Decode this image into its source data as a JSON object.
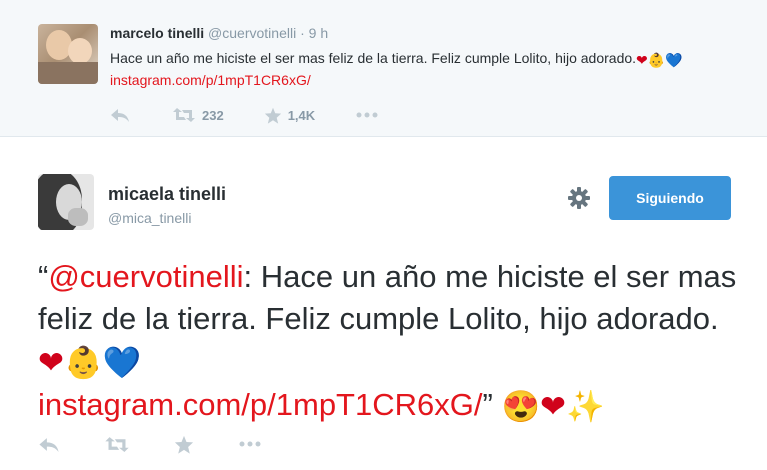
{
  "top_tweet": {
    "name": "marcelo tinelli",
    "handle": "@cuervotinelli",
    "separator": "·",
    "time": "9 h",
    "text": "Hace un año me hiciste el ser mas feliz de la tierra. Feliz cumple Lolito, hijo adorado.",
    "emojis": [
      "❤",
      "👶",
      "💙"
    ],
    "link": "instagram.com/p/1mpT1CR6xG/",
    "retweet_count": "232",
    "favorite_count": "1,4K"
  },
  "main_tweet": {
    "name": "micaela tinelli",
    "handle": "@mica_tinelli",
    "follow_label": "Siguiendo",
    "open_quote": "“",
    "mention": "@cuervotinelli",
    "text": ": Hace un año me hiciste el ser mas feliz de la tierra. Feliz cumple Lolito, hijo adorado.",
    "emojis": [
      "❤",
      "👶",
      "💙"
    ],
    "link": "instagram.com/p/1mpT1CR6xG/",
    "close_quote": "”",
    "trailing_emojis": [
      "😍",
      "❤",
      "✨"
    ]
  },
  "colors": {
    "link": "#e3161d",
    "follow_button": "#3b94d9",
    "muted": "#8899a6",
    "top_background": "#f5f8fa"
  }
}
